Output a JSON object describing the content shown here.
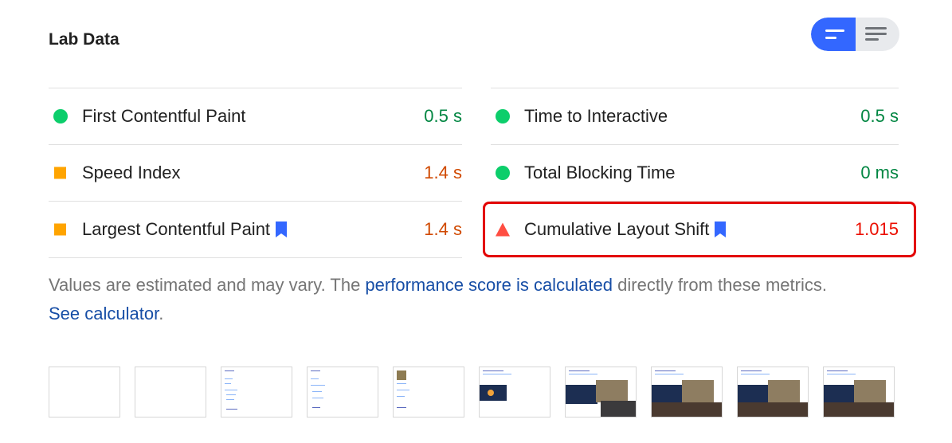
{
  "section_title": "Lab Data",
  "view_toggle": {
    "selected": "summary",
    "summary_icon": "bars-short-icon",
    "list_icon": "bars-full-icon"
  },
  "metrics": {
    "left": [
      {
        "label": "First Contentful Paint",
        "value": "0.5 s",
        "rating": "pass"
      },
      {
        "label": "Speed Index",
        "value": "1.4 s",
        "rating": "average"
      },
      {
        "label": "Largest Contentful Paint",
        "value": "1.4 s",
        "rating": "average",
        "bookmark": true
      }
    ],
    "right": [
      {
        "label": "Time to Interactive",
        "value": "0.5 s",
        "rating": "pass"
      },
      {
        "label": "Total Blocking Time",
        "value": "0 ms",
        "rating": "pass"
      },
      {
        "label": "Cumulative Layout Shift",
        "value": "1.015",
        "rating": "fail",
        "bookmark": true
      }
    ]
  },
  "note": {
    "part1": "Values are estimated and may vary. The ",
    "link1": "performance score is calculated",
    "part2": " directly from these metrics. ",
    "link2": "See calculator",
    "part3": "."
  },
  "colors": {
    "pass": "#0cce6b",
    "average": "#ffa400",
    "fail": "#ff4e42",
    "toggle_active": "#3367ff",
    "link": "#174ea6",
    "highlight_border": "#e30000"
  },
  "filmstrip": {
    "frame_count": 10
  }
}
